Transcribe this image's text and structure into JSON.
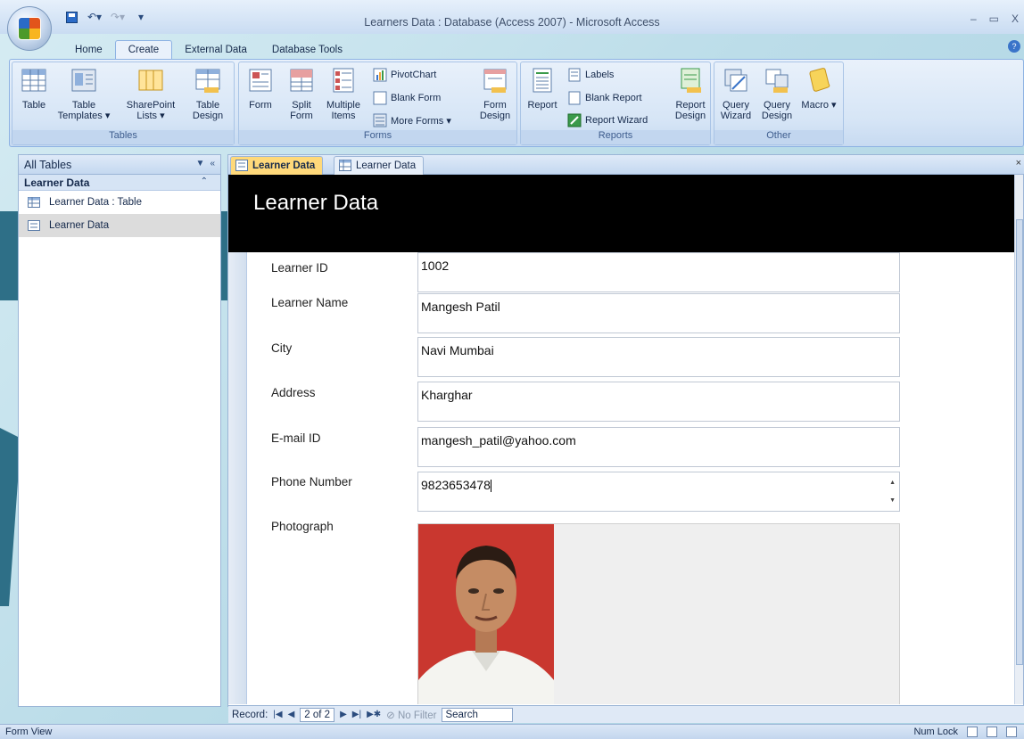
{
  "window": {
    "title": "Learners Data : Database (Access 2007) - Microsoft Access",
    "controls": [
      "–",
      "▭",
      "X"
    ]
  },
  "ribbon": {
    "tabs": [
      "Home",
      "Create",
      "External Data",
      "Database Tools"
    ],
    "active_tab": "Create",
    "groups": {
      "tables": {
        "label": "Tables",
        "buttons": [
          "Table",
          "Table Templates ▾",
          "SharePoint Lists ▾",
          "Table Design"
        ]
      },
      "forms": {
        "label": "Forms",
        "buttons": [
          "Form",
          "Split Form",
          "Multiple Items",
          "Form Design"
        ],
        "small": [
          "PivotChart",
          "Blank Form",
          "More Forms ▾"
        ]
      },
      "reports": {
        "label": "Reports",
        "buttons": [
          "Report",
          "Report Design"
        ],
        "small": [
          "Labels",
          "Blank Report",
          "Report Wizard"
        ]
      },
      "other": {
        "label": "Other",
        "buttons": [
          "Query Wizard",
          "Query Design",
          "Macro ▾"
        ]
      }
    }
  },
  "nav_pane": {
    "header": "All Tables",
    "group": "Learner Data",
    "items": [
      "Learner Data : Table",
      "Learner Data"
    ],
    "selected_index": 1
  },
  "document": {
    "tabs": [
      "Learner Data",
      "Learner Data"
    ],
    "active_tab_index": 0,
    "form_title": "Learner Data",
    "fields": [
      {
        "label": "Learner ID",
        "value": "1002"
      },
      {
        "label": "Learner Name",
        "value": "Mangesh Patil"
      },
      {
        "label": "City",
        "value": "Navi Mumbai"
      },
      {
        "label": "Address",
        "value": "Kharghar"
      },
      {
        "label": "E-mail ID",
        "value": "mangesh_patil@yahoo.com"
      },
      {
        "label": "Phone Number",
        "value": "9823653478"
      }
    ],
    "photo_label": "Photograph"
  },
  "record_nav": {
    "label": "Record:",
    "position": "2 of 2",
    "filter": "No Filter",
    "search": "Search"
  },
  "status": {
    "left": "Form View",
    "right": "Num Lock"
  },
  "colors": {
    "accent": "#2e6f87",
    "ribbon": "#d6e5f6",
    "form_header": "#000000",
    "active_tab": "#ffd97a"
  }
}
